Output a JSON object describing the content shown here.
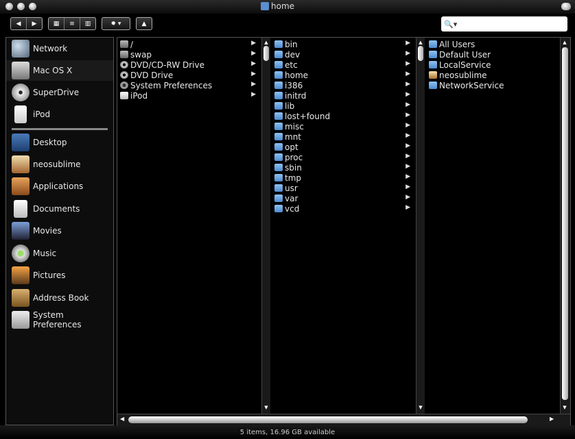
{
  "window": {
    "title": "home"
  },
  "toolbar": {
    "back_label": "◀",
    "forward_label": "▶",
    "view_icon_label": "▦",
    "view_list_label": "≡",
    "view_columns_label": "▥",
    "action_label": "✹ ▾",
    "eject_label": "▲"
  },
  "search": {
    "value": "",
    "placeholder": ""
  },
  "sidebar": {
    "devices": [
      {
        "label": "Network",
        "icon": "network-globe-icon"
      },
      {
        "label": "Mac OS X",
        "icon": "harddisk-icon"
      },
      {
        "label": "SuperDrive",
        "icon": "optical-drive-icon"
      },
      {
        "label": "iPod",
        "icon": "ipod-icon"
      }
    ],
    "places": [
      {
        "label": "Desktop",
        "icon": "desktop-icon"
      },
      {
        "label": "neosublime",
        "icon": "home-icon"
      },
      {
        "label": "Applications",
        "icon": "applications-icon"
      },
      {
        "label": "Documents",
        "icon": "documents-icon"
      },
      {
        "label": "Movies",
        "icon": "movies-icon"
      },
      {
        "label": "Music",
        "icon": "music-icon"
      },
      {
        "label": "Pictures",
        "icon": "pictures-icon"
      },
      {
        "label": "Address Book",
        "icon": "address-book-icon"
      },
      {
        "label": "System Preferences",
        "icon": "system-preferences-icon"
      }
    ]
  },
  "columns": {
    "col1": [
      {
        "label": "/",
        "icon": "drive"
      },
      {
        "label": "swap",
        "icon": "drive"
      },
      {
        "label": "DVD/CD-RW Drive",
        "icon": "disc"
      },
      {
        "label": "DVD Drive",
        "icon": "disc"
      },
      {
        "label": "System Preferences",
        "icon": "gear"
      },
      {
        "label": "iPod",
        "icon": "ipodi"
      }
    ],
    "col2": [
      {
        "label": "bin"
      },
      {
        "label": "dev"
      },
      {
        "label": "etc"
      },
      {
        "label": "home"
      },
      {
        "label": "i386"
      },
      {
        "label": "initrd"
      },
      {
        "label": "lib"
      },
      {
        "label": "lost+found"
      },
      {
        "label": "misc"
      },
      {
        "label": "mnt"
      },
      {
        "label": "opt"
      },
      {
        "label": "proc"
      },
      {
        "label": "sbin"
      },
      {
        "label": "tmp"
      },
      {
        "label": "usr"
      },
      {
        "label": "var"
      },
      {
        "label": "vcd"
      }
    ],
    "col3": [
      {
        "label": "All Users",
        "icon": "folder"
      },
      {
        "label": "Default User",
        "icon": "folder"
      },
      {
        "label": "LocalService",
        "icon": "folder"
      },
      {
        "label": "neosublime",
        "icon": "home"
      },
      {
        "label": "NetworkService",
        "icon": "folder"
      }
    ]
  },
  "status": {
    "text": "5 items, 16.96 GB available"
  }
}
